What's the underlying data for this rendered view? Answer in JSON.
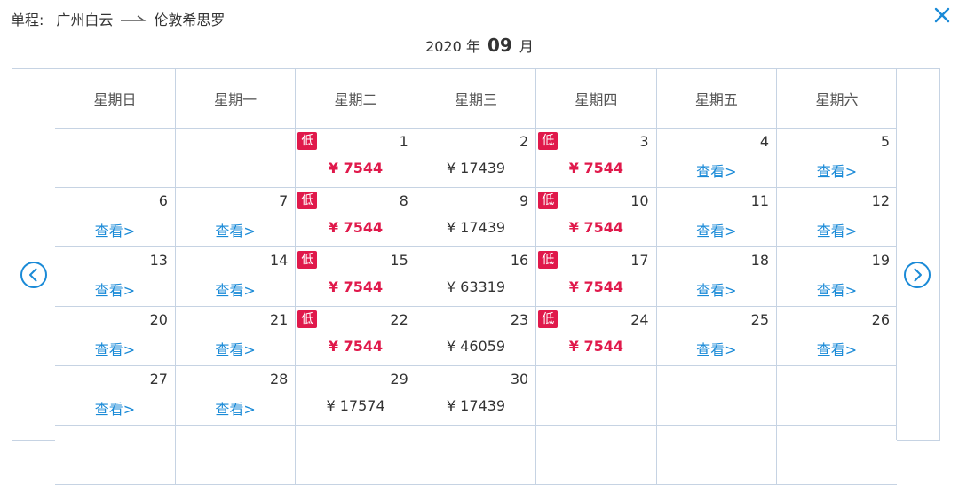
{
  "route": {
    "label": "单程:",
    "from": "广州白云",
    "to": "伦敦希思罗"
  },
  "month_header": {
    "year": "2020",
    "year_unit": "年",
    "month": "09",
    "month_unit": "月"
  },
  "weekdays": [
    "星期日",
    "星期一",
    "星期二",
    "星期三",
    "星期四",
    "星期五",
    "星期六"
  ],
  "low_label": "低",
  "view_label": "查看>",
  "currency": "¥",
  "icons": {
    "close": "close-icon",
    "prev": "chevron-left-icon",
    "next": "chevron-right-icon",
    "arrow": "arrow-right-icon"
  },
  "colors": {
    "low_price": "#e0194b",
    "link": "#1a8ad7",
    "border": "#c6d3e3"
  },
  "weeks": [
    [
      null,
      null,
      {
        "day": "1",
        "low": true,
        "price": "7544"
      },
      {
        "day": "2",
        "low": false,
        "price": "17439"
      },
      {
        "day": "3",
        "low": true,
        "price": "7544"
      },
      {
        "day": "4",
        "view": true
      },
      {
        "day": "5",
        "view": true
      }
    ],
    [
      {
        "day": "6",
        "view": true
      },
      {
        "day": "7",
        "view": true
      },
      {
        "day": "8",
        "low": true,
        "price": "7544"
      },
      {
        "day": "9",
        "low": false,
        "price": "17439"
      },
      {
        "day": "10",
        "low": true,
        "price": "7544"
      },
      {
        "day": "11",
        "view": true
      },
      {
        "day": "12",
        "view": true
      }
    ],
    [
      {
        "day": "13",
        "view": true
      },
      {
        "day": "14",
        "view": true
      },
      {
        "day": "15",
        "low": true,
        "price": "7544"
      },
      {
        "day": "16",
        "low": false,
        "price": "63319"
      },
      {
        "day": "17",
        "low": true,
        "price": "7544"
      },
      {
        "day": "18",
        "view": true
      },
      {
        "day": "19",
        "view": true
      }
    ],
    [
      {
        "day": "20",
        "view": true
      },
      {
        "day": "21",
        "view": true
      },
      {
        "day": "22",
        "low": true,
        "price": "7544"
      },
      {
        "day": "23",
        "low": false,
        "price": "46059"
      },
      {
        "day": "24",
        "low": true,
        "price": "7544"
      },
      {
        "day": "25",
        "view": true
      },
      {
        "day": "26",
        "view": true
      }
    ],
    [
      {
        "day": "27",
        "view": true
      },
      {
        "day": "28",
        "view": true
      },
      {
        "day": "29",
        "low": false,
        "price": "17574"
      },
      {
        "day": "30",
        "low": false,
        "price": "17439"
      },
      null,
      null,
      null
    ],
    [
      null,
      null,
      null,
      null,
      null,
      null,
      null
    ]
  ]
}
